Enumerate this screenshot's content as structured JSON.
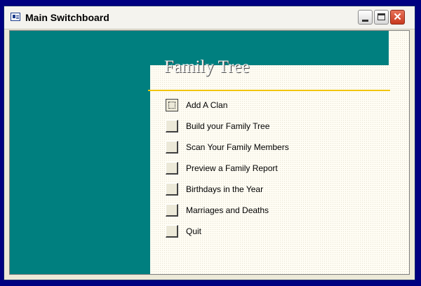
{
  "window": {
    "title": "Main Switchboard",
    "minimize_label": "_",
    "close_glyph": "✕"
  },
  "colors": {
    "desktop": "#000080",
    "panel": "#007F7F",
    "accent_rule": "#F2C400",
    "client_bg": "#FFFDF4"
  },
  "header": {
    "title": "Family Tree"
  },
  "menu": {
    "items": [
      {
        "label": "Add A Clan",
        "focused": true
      },
      {
        "label": "Build your Family Tree"
      },
      {
        "label": "Scan Your Family Members"
      },
      {
        "label": "Preview a Family Report"
      },
      {
        "label": "Birthdays in the Year"
      },
      {
        "label": "Marriages and Deaths"
      },
      {
        "label": "Quit"
      }
    ]
  }
}
